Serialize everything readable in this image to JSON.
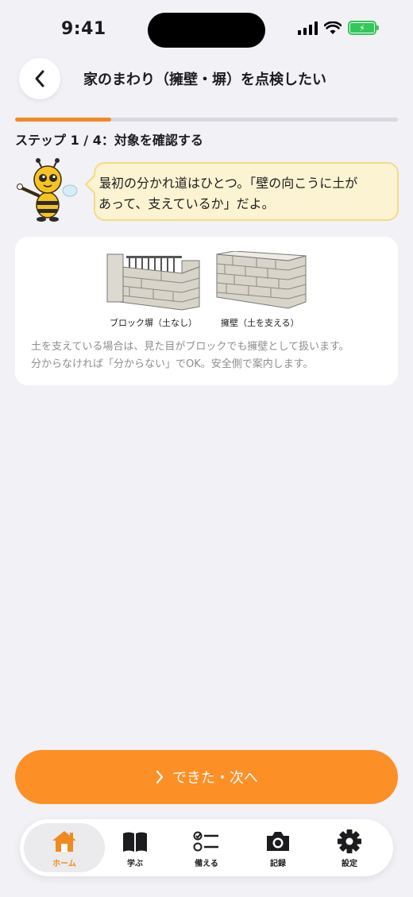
{
  "status_bar": {
    "time": "9:41"
  },
  "header": {
    "title": "家のまわり（擁壁・塀）を点検したい"
  },
  "progress": {
    "step": 1,
    "total": 4,
    "fraction": 0.25
  },
  "step_label": "ステップ 1 / 4：対象を確認する",
  "bubble": {
    "line1": "最初の分かれ道はひとつ。「壁の向こうに土が",
    "line2": "あって、支えているか」だよ。"
  },
  "card": {
    "option_a_caption": "ブロック塀（土なし）",
    "option_b_caption": "擁壁（土を支える）",
    "note_line1": "土を支えている場合は、見た目がブロックでも擁壁として扱います。",
    "note_line2": "分からなければ「分からない」でOK。安全側で案内します。"
  },
  "primary_button": {
    "label": "できた・次へ"
  },
  "tab_bar": {
    "items": [
      {
        "label": "ホーム",
        "icon": "home-icon",
        "active": true
      },
      {
        "label": "学ぶ",
        "icon": "book-icon",
        "active": false
      },
      {
        "label": "備える",
        "icon": "checklist-icon",
        "active": false
      },
      {
        "label": "記録",
        "icon": "camera-icon",
        "active": false
      },
      {
        "label": "設定",
        "icon": "gear-icon",
        "active": false
      }
    ]
  },
  "colors": {
    "accent": "#fd8f27",
    "active_tab": "#f08a20",
    "bubble_bg": "#fbf3d2",
    "battery": "#34c759"
  }
}
